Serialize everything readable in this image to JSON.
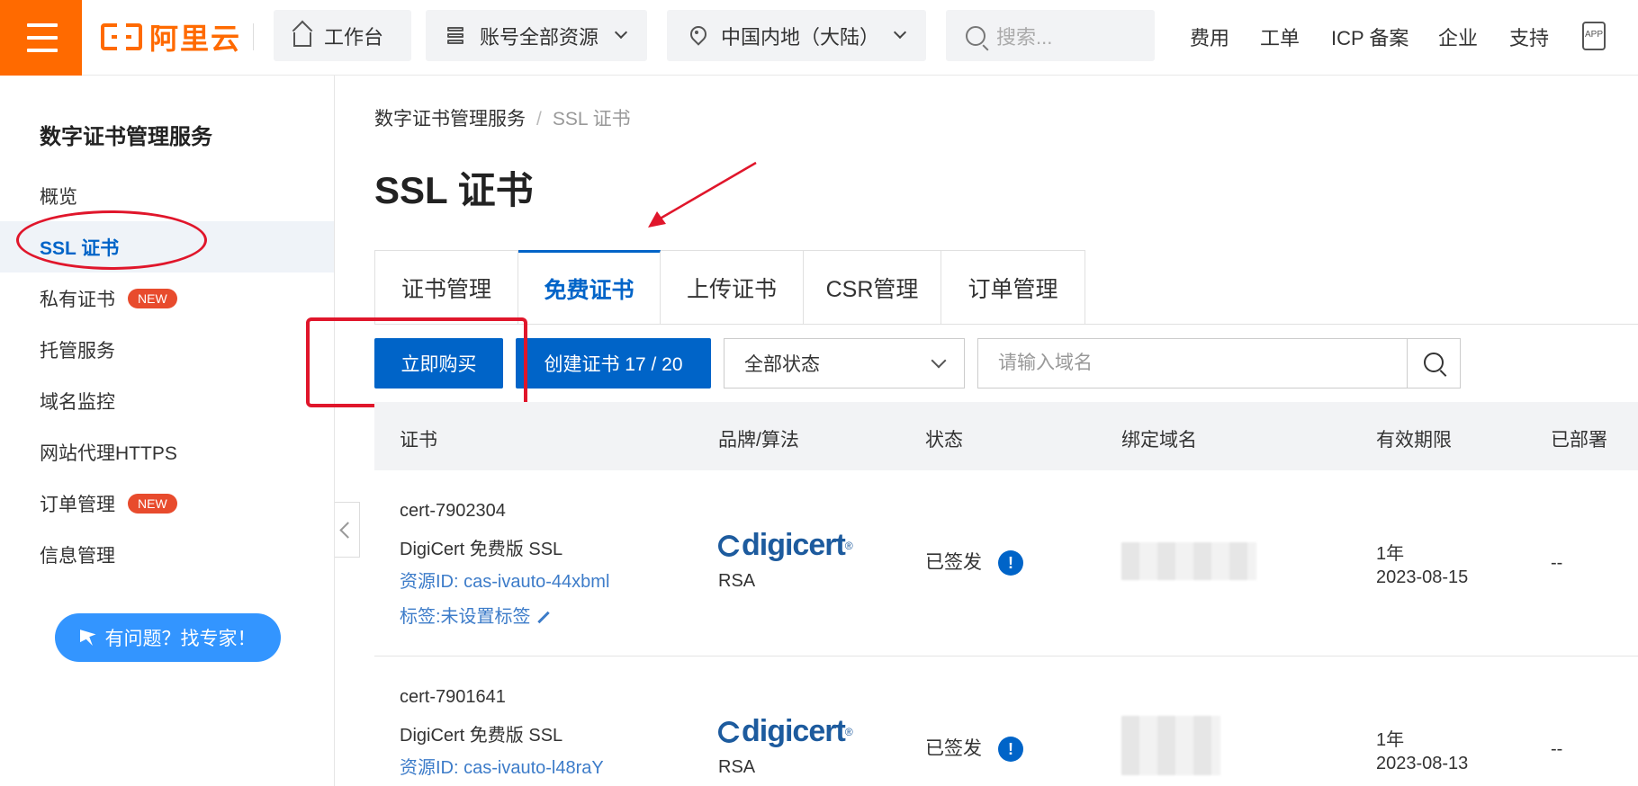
{
  "topbar": {
    "logo_text": "阿里云",
    "workbench": "工作台",
    "resources": "账号全部资源",
    "region": "中国内地（大陆）",
    "search_placeholder": "搜索...",
    "nav": [
      "费用",
      "工单",
      "ICP 备案",
      "企业",
      "支持"
    ],
    "app_label": "APP"
  },
  "sidebar": {
    "title": "数字证书管理服务",
    "items": [
      {
        "label": "概览"
      },
      {
        "label": "SSL 证书",
        "active": true
      },
      {
        "label": "私有证书",
        "badge": "NEW"
      },
      {
        "label": "托管服务"
      },
      {
        "label": "域名监控"
      },
      {
        "label": "网站代理HTTPS"
      },
      {
        "label": "订单管理",
        "badge": "NEW"
      },
      {
        "label": "信息管理"
      }
    ],
    "help_button": "有问题？找专家！"
  },
  "breadcrumb": {
    "root": "数字证书管理服务",
    "sep": "/",
    "current": "SSL 证书"
  },
  "page_title": "SSL 证书",
  "tabs": [
    "证书管理",
    "免费证书",
    "上传证书",
    "CSR管理",
    "订单管理"
  ],
  "toolbar": {
    "buy_now": "立即购买",
    "create_cert": "创建证书 17 / 20",
    "status_select": "全部状态",
    "domain_placeholder": "请输入域名"
  },
  "table": {
    "headers": [
      "证书",
      "品牌/算法",
      "状态",
      "绑定域名",
      "有效期限",
      "已部署"
    ],
    "rows": [
      {
        "name": "cert-7902304",
        "type": "DigiCert 免费版 SSL",
        "resource_id": "资源ID: cas-ivauto-44xbml",
        "tag": "标签:未设置标签",
        "brand": "digicert",
        "algo": "RSA",
        "status": "已签发",
        "validity": "1年",
        "date": "2023-08-15",
        "deployed": "--"
      },
      {
        "name": "cert-7901641",
        "type": "DigiCert 免费版 SSL",
        "resource_id": "资源ID: cas-ivauto-l48raY",
        "brand": "digicert",
        "algo": "RSA",
        "status": "已签发",
        "validity": "1年",
        "date": "2023-08-13",
        "deployed": "--"
      }
    ]
  },
  "colors": {
    "accent": "#0064c8",
    "brand_orange": "#ff6a00",
    "annotation_red": "#e0162b",
    "badge_red": "#e84b2d"
  }
}
